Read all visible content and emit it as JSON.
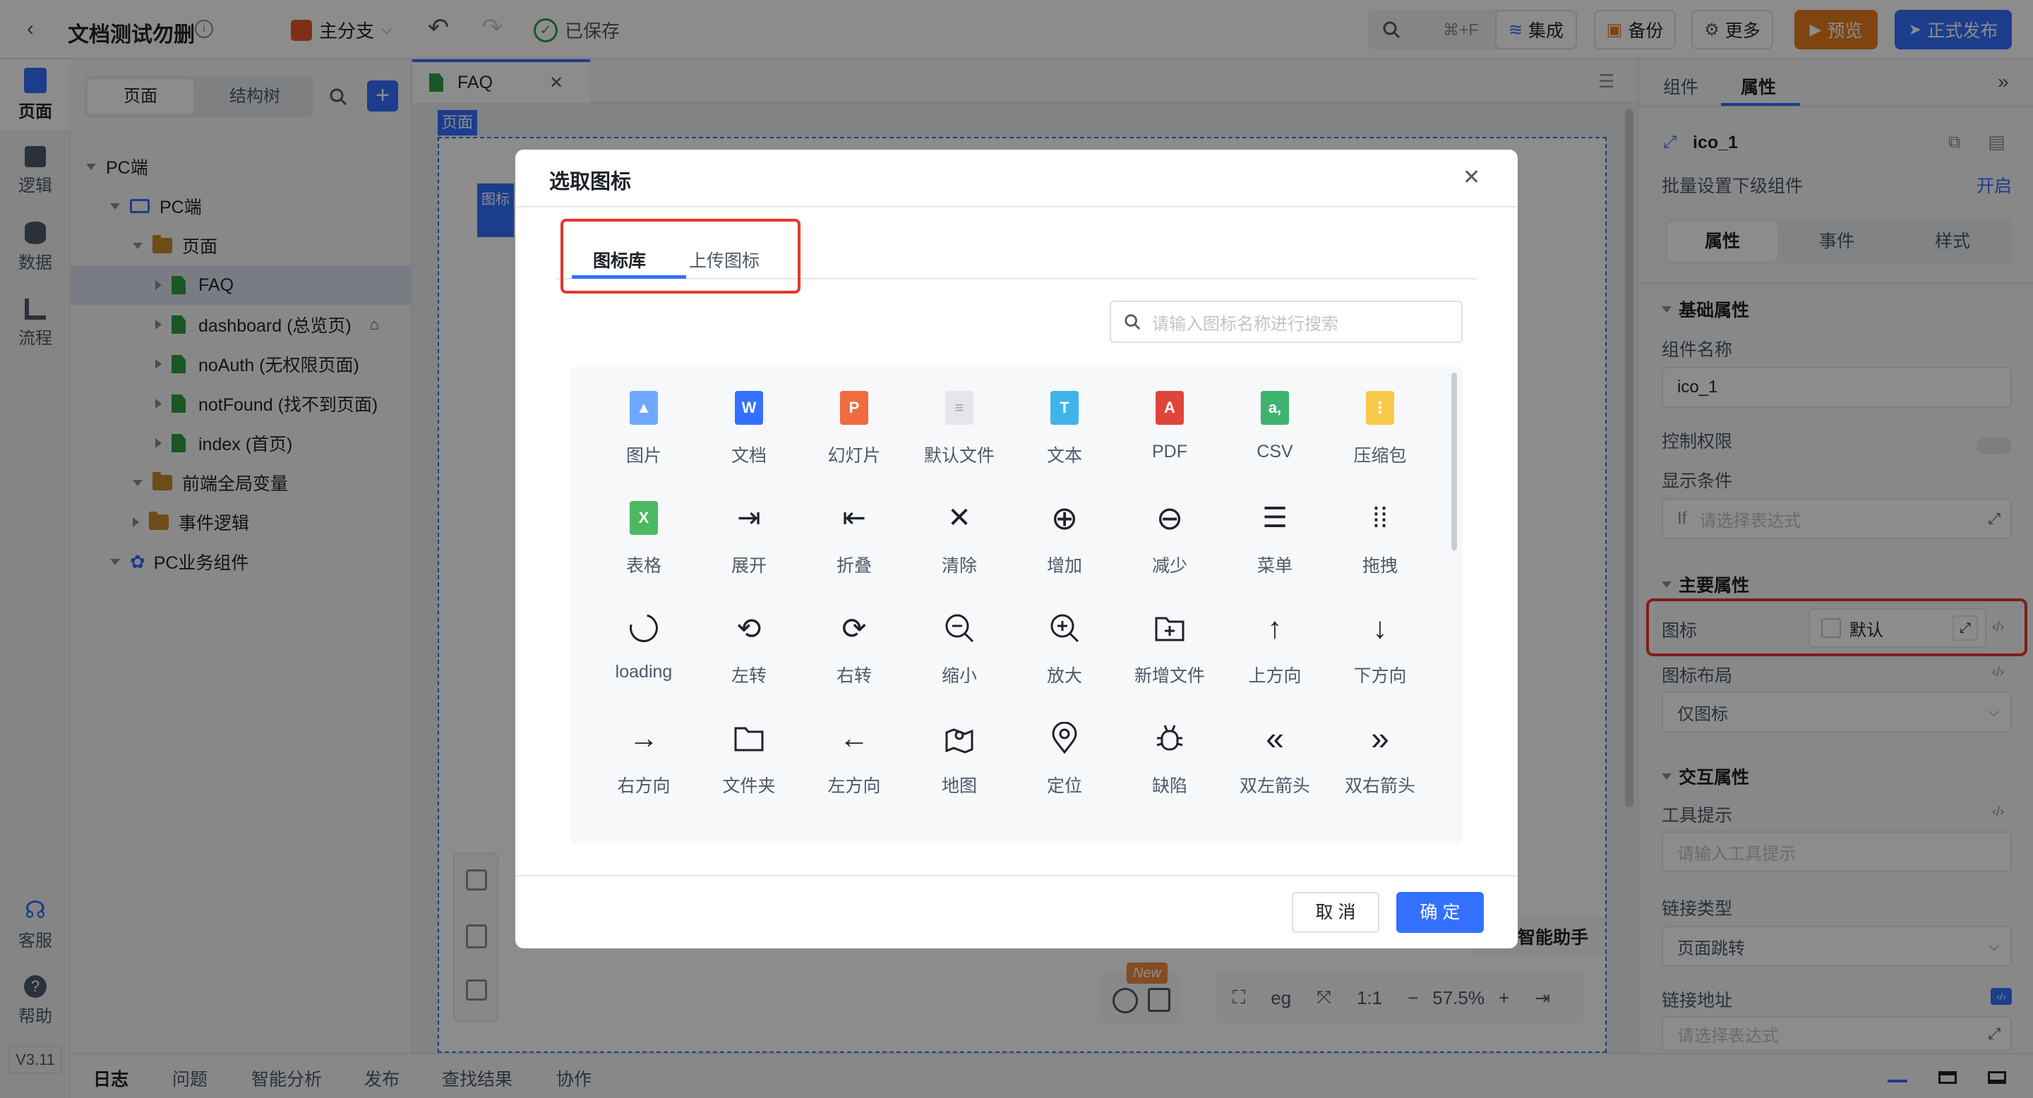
{
  "app": {
    "title": "文档测试勿删",
    "branch": "主分支",
    "saved": "已保存",
    "shortcut": "⌘+F",
    "integrate": "集成",
    "backup": "备份",
    "more": "更多",
    "preview": "预览",
    "publish": "正式发布",
    "version": "V3.11"
  },
  "rail": {
    "items": [
      {
        "label": "页面",
        "icon": "page-icon"
      },
      {
        "label": "逻辑",
        "icon": "logic-icon"
      },
      {
        "label": "数据",
        "icon": "database-icon"
      },
      {
        "label": "流程",
        "icon": "flow-icon"
      }
    ],
    "service": "客服",
    "help": "帮助"
  },
  "left_panel": {
    "tab_pages": "页面",
    "tab_tree": "结构树",
    "tree": [
      {
        "label": "PC端"
      },
      {
        "label": "PC端"
      },
      {
        "label": "页面"
      },
      {
        "label": "FAQ"
      },
      {
        "label": "dashboard (总览页)"
      },
      {
        "label": "noAuth (无权限页面)"
      },
      {
        "label": "notFound (找不到页面)"
      },
      {
        "label": "index (首页)"
      },
      {
        "label": "前端全局变量"
      },
      {
        "label": "事件逻辑"
      },
      {
        "label": "PC业务组件"
      }
    ]
  },
  "canvas": {
    "tab": "FAQ",
    "page_tag": "页面",
    "comp_tag": "图标",
    "assistant": "智能助手",
    "new_badge": "New",
    "zoom": "57.5%",
    "ratio": "1:1"
  },
  "right_panel": {
    "tab_components": "组件",
    "tab_properties": "属性",
    "component_name": "ico_1",
    "batch_label": "批量设置下级组件",
    "batch_action": "开启",
    "seg_props": "属性",
    "seg_events": "事件",
    "seg_styles": "样式",
    "sec_basic": "基础属性",
    "name_label": "组件名称",
    "name_value": "ico_1",
    "perm_label": "控制权限",
    "cond_label": "显示条件",
    "cond_prefix": "If",
    "cond_placeholder": "请选择表达式",
    "sec_main": "主要属性",
    "icon_label": "图标",
    "icon_value": "默认",
    "layout_label": "图标布局",
    "layout_value": "仅图标",
    "sec_interact": "交互属性",
    "tooltip_label": "工具提示",
    "tooltip_placeholder": "请输入工具提示",
    "link_type_label": "链接类型",
    "link_type_value": "页面跳转",
    "link_addr_label": "链接地址",
    "link_addr_placeholder": "请选择表达式"
  },
  "bottom_bar": [
    "日志",
    "问题",
    "智能分析",
    "发布",
    "查找结果",
    "协作"
  ],
  "modal": {
    "title": "选取图标",
    "tab_library": "图标库",
    "tab_upload": "上传图标",
    "search_placeholder": "请输入图标名称进行搜索",
    "cancel": "取 消",
    "confirm": "确 定",
    "icons": [
      {
        "label": "图片",
        "icon": "image-file-icon"
      },
      {
        "label": "文档",
        "icon": "word-file-icon"
      },
      {
        "label": "幻灯片",
        "icon": "ppt-file-icon"
      },
      {
        "label": "默认文件",
        "icon": "default-file-icon"
      },
      {
        "label": "文本",
        "icon": "text-file-icon"
      },
      {
        "label": "PDF",
        "icon": "pdf-file-icon"
      },
      {
        "label": "CSV",
        "icon": "csv-file-icon"
      },
      {
        "label": "压缩包",
        "icon": "zip-file-icon"
      },
      {
        "label": "表格",
        "icon": "excel-file-icon"
      },
      {
        "label": "展开",
        "icon": "expand-icon"
      },
      {
        "label": "折叠",
        "icon": "collapse-icon"
      },
      {
        "label": "清除",
        "icon": "close-icon"
      },
      {
        "label": "增加",
        "icon": "plus-circle-icon"
      },
      {
        "label": "减少",
        "icon": "minus-circle-icon"
      },
      {
        "label": "菜单",
        "icon": "menu-icon"
      },
      {
        "label": "拖拽",
        "icon": "drag-icon"
      },
      {
        "label": "loading",
        "icon": "loading-icon"
      },
      {
        "label": "左转",
        "icon": "rotate-left-icon"
      },
      {
        "label": "右转",
        "icon": "rotate-right-icon"
      },
      {
        "label": "缩小",
        "icon": "zoom-out-icon"
      },
      {
        "label": "放大",
        "icon": "zoom-in-icon"
      },
      {
        "label": "新增文件",
        "icon": "folder-add-icon"
      },
      {
        "label": "上方向",
        "icon": "arrow-up-icon"
      },
      {
        "label": "下方向",
        "icon": "arrow-down-icon"
      },
      {
        "label": "右方向",
        "icon": "arrow-right-icon"
      },
      {
        "label": "文件夹",
        "icon": "folder-icon"
      },
      {
        "label": "左方向",
        "icon": "arrow-left-icon"
      },
      {
        "label": "地图",
        "icon": "map-icon"
      },
      {
        "label": "定位",
        "icon": "location-icon"
      },
      {
        "label": "缺陷",
        "icon": "bug-icon"
      },
      {
        "label": "双左箭头",
        "icon": "double-left-icon"
      },
      {
        "label": "双右箭头",
        "icon": "double-right-icon"
      }
    ]
  },
  "colors": {
    "primary": "#3370ff",
    "highlight": "#e5372b",
    "publish": "#3370ff",
    "preview": "#e87c1e"
  }
}
